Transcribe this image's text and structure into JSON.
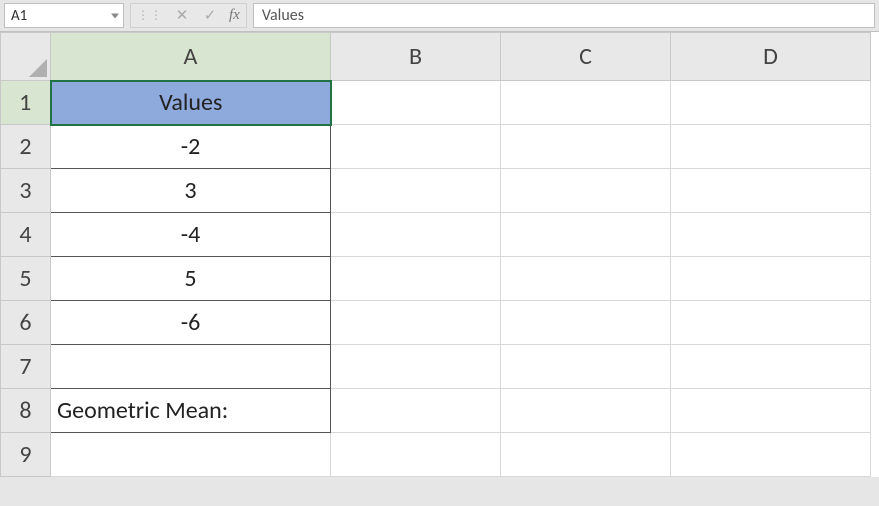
{
  "formula_bar": {
    "name_box": "A1",
    "cancel_glyph": "✕",
    "enter_glyph": "✓",
    "fx_label": "fx",
    "formula_value": "Values"
  },
  "columns": [
    "A",
    "B",
    "C",
    "D"
  ],
  "rows": [
    "1",
    "2",
    "3",
    "4",
    "5",
    "6",
    "7",
    "8",
    "9"
  ],
  "selected_cell": "A1",
  "cells": {
    "A1": "Values",
    "A2": "-2",
    "A3": "3",
    "A4": "-4",
    "A5": "5",
    "A6": "-6",
    "A7": "",
    "A8": "Geometric Mean:",
    "A9": ""
  }
}
